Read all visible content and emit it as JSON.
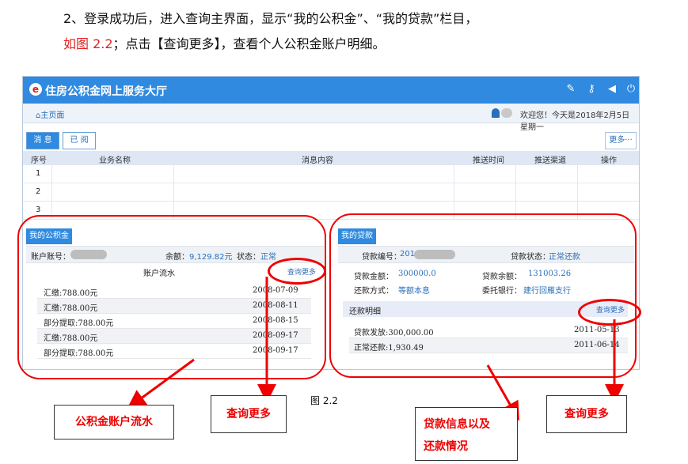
{
  "intro": {
    "line1": "2、登录成功后，进入查询主界面，显示“我的公积金”、“我的贷款”栏目，",
    "line2_red": "如图 2.2",
    "line2_rest": "；点击【查询更多】，查看个人公积金账户明细。"
  },
  "app": {
    "logo_glyph": "e",
    "title": "住房公积金网上服务大厅",
    "toolbar_icons": [
      "edit-icon",
      "key-icon",
      "speaker-icon",
      "power-icon"
    ],
    "breadcrumb": "主页面",
    "welcome": "欢迎您！今天是2018年2月5日 星期一"
  },
  "messages": {
    "tabs": [
      "消 息",
      "已 阅"
    ],
    "more_button": "更多···",
    "columns": [
      "序号",
      "业务名称",
      "消息内容",
      "推送时间",
      "推送渠道",
      "操作"
    ],
    "rows": [
      "1",
      "2",
      "3"
    ]
  },
  "fund": {
    "tag": "我的公积金",
    "account_label": "账户账号：",
    "balance_label": "余额：",
    "balance_value": "9,129.82元",
    "status_label": "状态：",
    "status_value": "正常",
    "flow_title": "账户流水",
    "more_link": "查询更多",
    "flow": [
      {
        "desc": "汇缴:788.00元",
        "date": "2008-07-09"
      },
      {
        "desc": "汇缴:788.00元",
        "date": "2008-08-11"
      },
      {
        "desc": "部分提取:788.00元",
        "date": "2008-08-15"
      },
      {
        "desc": "汇缴:788.00元",
        "date": "2008-09-17"
      },
      {
        "desc": "部分提取:788.00元",
        "date": "2008-09-17"
      }
    ]
  },
  "loan": {
    "tag": "我的贷款",
    "number_label": "贷款编号：",
    "number_prefix": "201",
    "status_label": "贷款状态：",
    "status_value": "正常还款",
    "amount_label": "贷款金额：",
    "amount_value": "300000.0",
    "remain_label": "贷款余额：",
    "remain_value": "131003.26",
    "method_label": "还款方式：",
    "method_value": "等额本息",
    "bank_label": "委托银行：",
    "bank_value": "建行回雁支行",
    "detail_title": "还款明细",
    "more_link": "查询更多",
    "detail": [
      {
        "desc": "贷款发放:300,000.00",
        "date": "2011-05-13"
      },
      {
        "desc": "正常还款:1,930.49",
        "date": "2011-06-14"
      }
    ]
  },
  "callouts": {
    "fund_flow": "公积金账户流水",
    "query_more_1": "查询更多",
    "loan_info_line1": "贷款信息以及",
    "loan_info_line2": "还款情况",
    "query_more_2": "查询更多"
  },
  "caption": "图 2.2",
  "colors": {
    "accent": "#2f8ae0",
    "annotation": "#e00000"
  }
}
